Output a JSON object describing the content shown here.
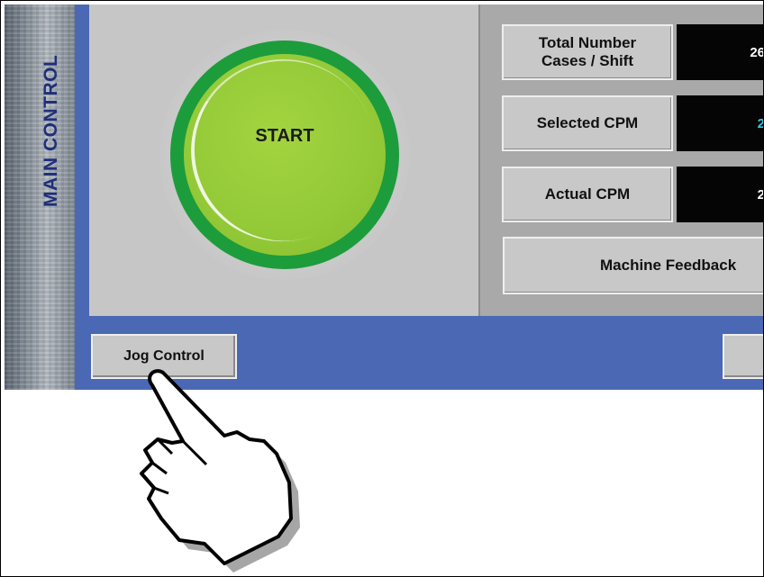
{
  "side_tab": {
    "label": "MAIN CONTROL"
  },
  "start_button": {
    "label": "START"
  },
  "stats": [
    {
      "label_line1": "Total Number",
      "label_line2": "Cases / Shift",
      "value": "26"
    },
    {
      "label": "Selected CPM",
      "value": "2"
    },
    {
      "label": "Actual CPM",
      "value": "2"
    }
  ],
  "feedback_button": {
    "label": "Machine Feedback"
  },
  "jog_button": {
    "label": "Jog Control"
  },
  "colors": {
    "frame_blue": "#4a68b4",
    "panel_gray": "#c6c6c6",
    "start_green": "#93c937",
    "ring_green": "#1d9c3c",
    "value_cyan": "#33c4e6"
  },
  "icons": {
    "pointer": "pointing-hand-icon"
  }
}
